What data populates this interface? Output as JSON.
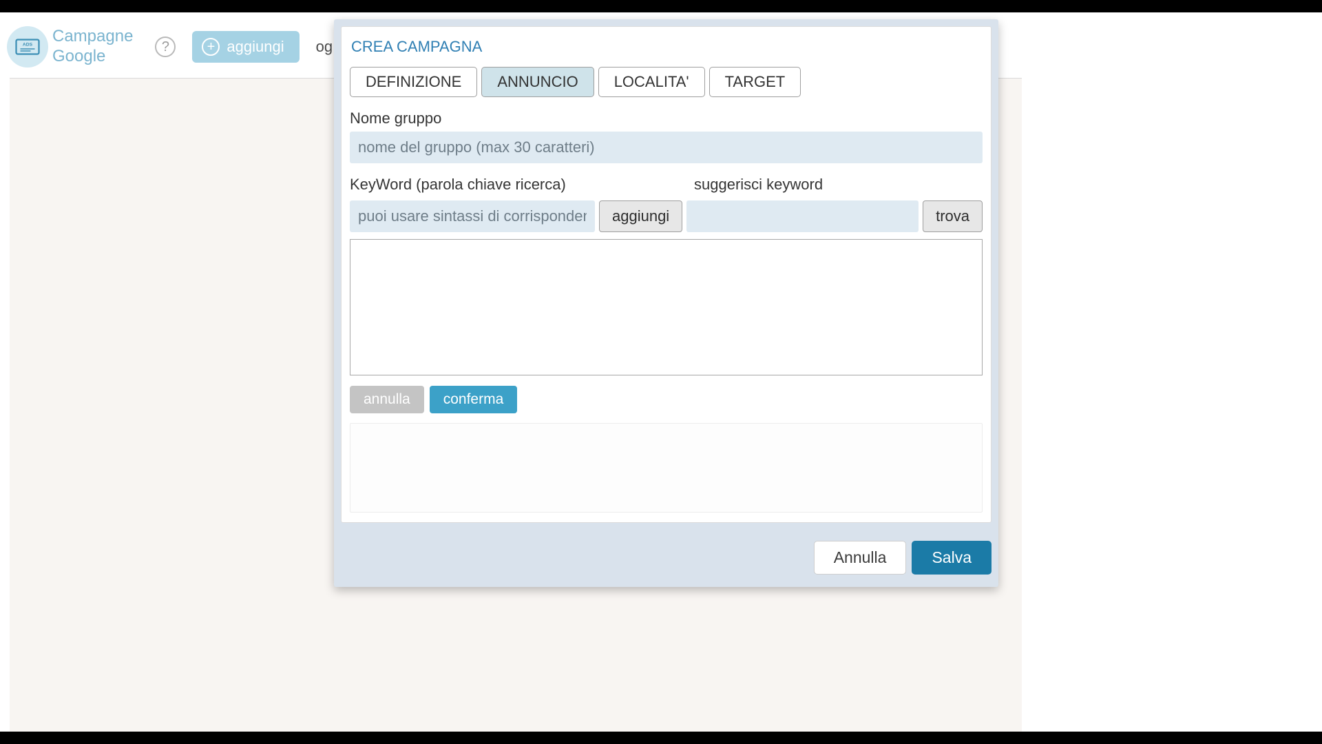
{
  "header": {
    "title_line1": "Campagne",
    "title_line2": "Google",
    "help_glyph": "?",
    "add_label": "aggiungi",
    "stray_text": "og",
    "icon_badge": "ADS"
  },
  "modal": {
    "title": "CREA CAMPAGNA",
    "tabs": [
      {
        "label": "DEFINIZIONE",
        "active": false
      },
      {
        "label": "ANNUNCIO",
        "active": true
      },
      {
        "label": "LOCALITA'",
        "active": false
      },
      {
        "label": "TARGET",
        "active": false
      }
    ],
    "group_name_label": "Nome gruppo",
    "group_name_placeholder": "nome del gruppo (max 30 caratteri)",
    "keyword_label": "KeyWord (parola chiave ricerca)",
    "keyword_placeholder": "puoi usare sintassi di corrispondenza",
    "keyword_add_btn": "aggiungi",
    "suggest_label": "suggerisci keyword",
    "suggest_placeholder": "",
    "suggest_find_btn": "trova",
    "cancel_small": "annulla",
    "confirm_small": "conferma",
    "footer_cancel": "Annulla",
    "footer_save": "Salva"
  }
}
